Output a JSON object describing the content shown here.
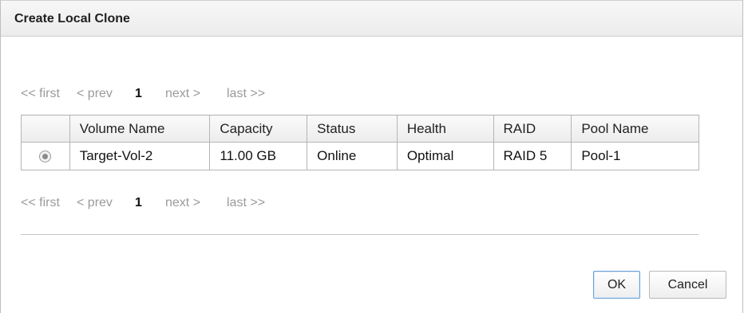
{
  "dialog": {
    "title": "Create Local Clone"
  },
  "pager": {
    "first": "<< first",
    "prev": "< prev",
    "current": "1",
    "next": "next >",
    "last": "last >>"
  },
  "table": {
    "columns": [
      "",
      "Volume Name",
      "Capacity",
      "Status",
      "Health",
      "RAID",
      "Pool Name"
    ],
    "rows": [
      {
        "selected": true,
        "volume_name": "Target-Vol-2",
        "capacity": "11.00 GB",
        "status": "Online",
        "health": "Optimal",
        "raid": "RAID 5",
        "pool_name": "Pool-1"
      }
    ]
  },
  "status_colors": {
    "online": "#2f8a1f",
    "optimal": "#2f8a1f"
  },
  "buttons": {
    "ok": "OK",
    "cancel": "Cancel"
  }
}
